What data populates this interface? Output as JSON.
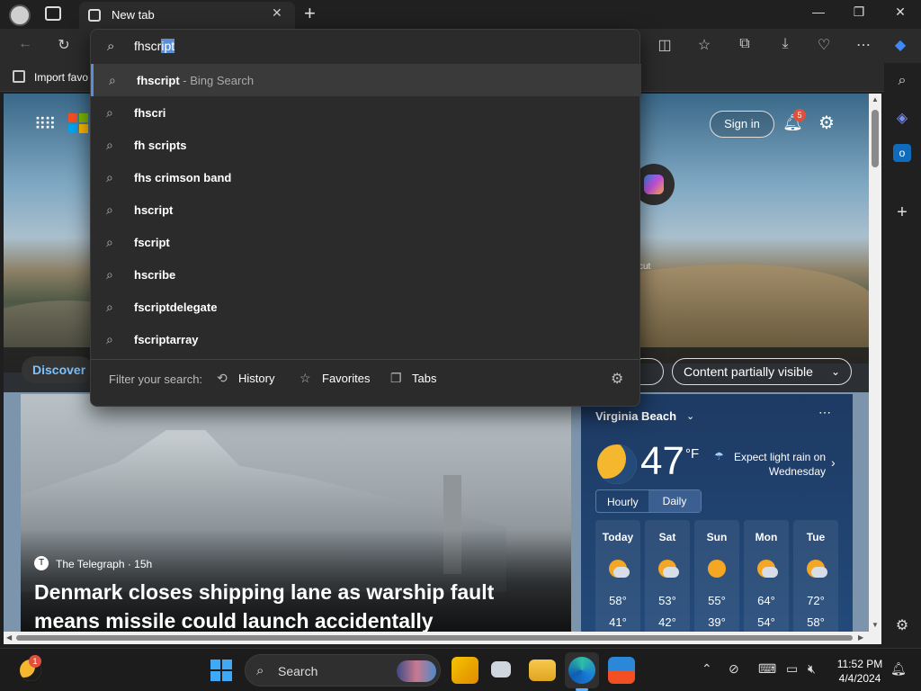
{
  "window": {
    "tab_title": "New tab",
    "minimize_icon": "—",
    "restore_icon": "❐",
    "close_icon": "✕"
  },
  "favorites_bar": {
    "import_label": "Import favo"
  },
  "omnibox": {
    "typed": "fhscr",
    "autocomplete": "ipt",
    "suggestions": [
      {
        "text": "fhscript",
        "sub": " - Bing Search",
        "active": true
      },
      {
        "text": "fhscri",
        "sub": ""
      },
      {
        "text": "fh scripts",
        "sub": ""
      },
      {
        "text": "fhs crimson band",
        "sub": ""
      },
      {
        "text": "hscript",
        "sub": ""
      },
      {
        "text": "fscript",
        "sub": ""
      },
      {
        "text": "hscribe",
        "sub": ""
      },
      {
        "text": "fscriptdelegate",
        "sub": ""
      },
      {
        "text": "fscriptarray",
        "sub": ""
      }
    ],
    "filter_label": "Filter your search:",
    "filters": [
      "History",
      "Favorites",
      "Tabs"
    ]
  },
  "page": {
    "sign_in": "Sign in",
    "notification_count": "5",
    "hero_caption": "cut",
    "discover": "Discover",
    "personalize_partial": "ze",
    "content_visibility": "Content partially visible"
  },
  "news": {
    "source": "The Telegraph · 15h",
    "headline": "Denmark closes shipping lane as warship fault means missile could launch accidentally"
  },
  "weather": {
    "location": "Virginia Beach",
    "temp": "47",
    "unit": "°F",
    "alert": "Expect light rain on Wednesday",
    "tab_hourly": "Hourly",
    "tab_daily": "Daily",
    "forecast": [
      {
        "day": "Today",
        "hi": "58°",
        "lo": "41°",
        "icon": "partly-cloudy"
      },
      {
        "day": "Sat",
        "hi": "53°",
        "lo": "42°",
        "icon": "cloudy"
      },
      {
        "day": "Sun",
        "hi": "55°",
        "lo": "39°",
        "icon": "sunny"
      },
      {
        "day": "Mon",
        "hi": "64°",
        "lo": "54°",
        "icon": "partly-cloudy"
      },
      {
        "day": "Tue",
        "hi": "72°",
        "lo": "58°",
        "icon": "partly-cloudy"
      }
    ]
  },
  "taskbar": {
    "weather_badge": "1",
    "search_label": "Search",
    "time": "11:52 PM",
    "date": "4/4/2024"
  },
  "colors": {
    "accent": "#5a8fd6",
    "taskbar_bg": "#1c1c1c",
    "badge": "#e0513d"
  }
}
